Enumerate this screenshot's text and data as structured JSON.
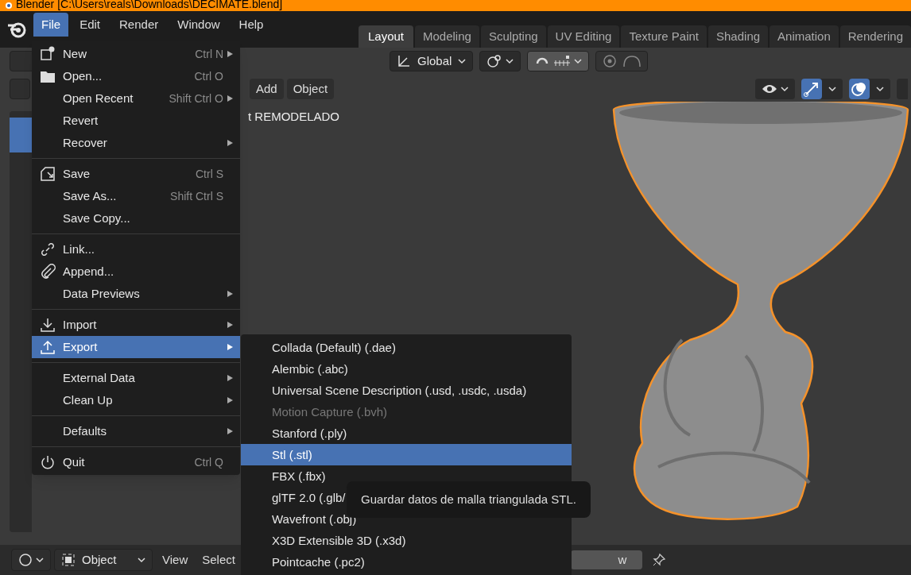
{
  "title_bar": {
    "title": "Blender [C:\\Users\\reals\\Downloads\\DECIMATE.blend]"
  },
  "menu_bar": {
    "items": [
      {
        "label": "File",
        "selected": true
      },
      {
        "label": "Edit",
        "selected": false
      },
      {
        "label": "Render",
        "selected": false
      },
      {
        "label": "Window",
        "selected": false
      },
      {
        "label": "Help",
        "selected": false
      }
    ]
  },
  "workspace_tabs": [
    {
      "label": "Layout",
      "selected": true
    },
    {
      "label": "Modeling",
      "selected": false
    },
    {
      "label": "Sculpting",
      "selected": false
    },
    {
      "label": "UV Editing",
      "selected": false
    },
    {
      "label": "Texture Paint",
      "selected": false
    },
    {
      "label": "Shading",
      "selected": false
    },
    {
      "label": "Animation",
      "selected": false
    },
    {
      "label": "Rendering",
      "selected": false
    }
  ],
  "tool_header": {
    "transform_orientation": "Global",
    "proportional_edit_on": false
  },
  "viewport_header": {
    "menus": [
      "Add",
      "Object"
    ],
    "gizmo_on": true,
    "overlays_on": true
  },
  "viewport": {
    "object_info": "t REMODELADO"
  },
  "file_menu": {
    "items": [
      {
        "kind": "item",
        "label": "New",
        "shortcut": "Ctrl N",
        "submenu": true,
        "selected": false
      },
      {
        "kind": "item",
        "label": "Open...",
        "shortcut": "Ctrl O",
        "submenu": false,
        "selected": false
      },
      {
        "kind": "item",
        "label": "Open Recent",
        "shortcut": "Shift Ctrl O",
        "submenu": true,
        "selected": false
      },
      {
        "kind": "item",
        "label": "Revert",
        "submenu": false,
        "selected": false
      },
      {
        "kind": "item",
        "label": "Recover",
        "submenu": true,
        "selected": false
      },
      {
        "kind": "separator"
      },
      {
        "kind": "item",
        "label": "Save",
        "shortcut": "Ctrl S",
        "submenu": false,
        "selected": false
      },
      {
        "kind": "item",
        "label": "Save As...",
        "shortcut": "Shift Ctrl S",
        "submenu": false,
        "selected": false
      },
      {
        "kind": "item",
        "label": "Save Copy...",
        "submenu": false,
        "selected": false
      },
      {
        "kind": "separator"
      },
      {
        "kind": "item",
        "label": "Link...",
        "submenu": false,
        "selected": false
      },
      {
        "kind": "item",
        "label": "Append...",
        "submenu": false,
        "selected": false
      },
      {
        "kind": "item",
        "label": "Data Previews",
        "submenu": true,
        "selected": false
      },
      {
        "kind": "separator"
      },
      {
        "kind": "item",
        "label": "Import",
        "submenu": true,
        "selected": false
      },
      {
        "kind": "item",
        "label": "Export",
        "submenu": true,
        "selected": true
      },
      {
        "kind": "separator"
      },
      {
        "kind": "item",
        "label": "External Data",
        "submenu": true,
        "selected": false
      },
      {
        "kind": "item",
        "label": "Clean Up",
        "submenu": true,
        "selected": false
      },
      {
        "kind": "separator"
      },
      {
        "kind": "item",
        "label": "Defaults",
        "submenu": true,
        "selected": false
      },
      {
        "kind": "separator"
      },
      {
        "kind": "item",
        "label": "Quit",
        "shortcut": "Ctrl Q",
        "submenu": false,
        "selected": false
      }
    ]
  },
  "export_menu": {
    "items": [
      {
        "label": "Collada (Default) (.dae)",
        "disabled": false,
        "selected": false
      },
      {
        "label": "Alembic (.abc)",
        "disabled": false,
        "selected": false
      },
      {
        "label": "Universal Scene Description (.usd, .usdc, .usda)",
        "disabled": false,
        "selected": false
      },
      {
        "label": "Motion Capture (.bvh)",
        "disabled": true,
        "selected": false
      },
      {
        "label": "Stanford (.ply)",
        "disabled": false,
        "selected": false
      },
      {
        "label": "Stl (.stl)",
        "disabled": false,
        "selected": true
      },
      {
        "label": "FBX (.fbx)",
        "disabled": false,
        "selected": false
      },
      {
        "label": "glTF 2.0 (.glb/",
        "disabled": false,
        "selected": false
      },
      {
        "label": "Wavefront (.obj)",
        "disabled": false,
        "selected": false
      },
      {
        "label": "X3D Extensible 3D (.x3d)",
        "disabled": false,
        "selected": false
      },
      {
        "label": "Pointcache (.pc2)",
        "disabled": false,
        "selected": false
      }
    ]
  },
  "tooltip": {
    "text": "Guardar datos de malla triangulada STL."
  },
  "bottom_bar": {
    "mode": "Object",
    "menus": [
      "View",
      "Select"
    ],
    "field_visible_text": "w"
  }
}
